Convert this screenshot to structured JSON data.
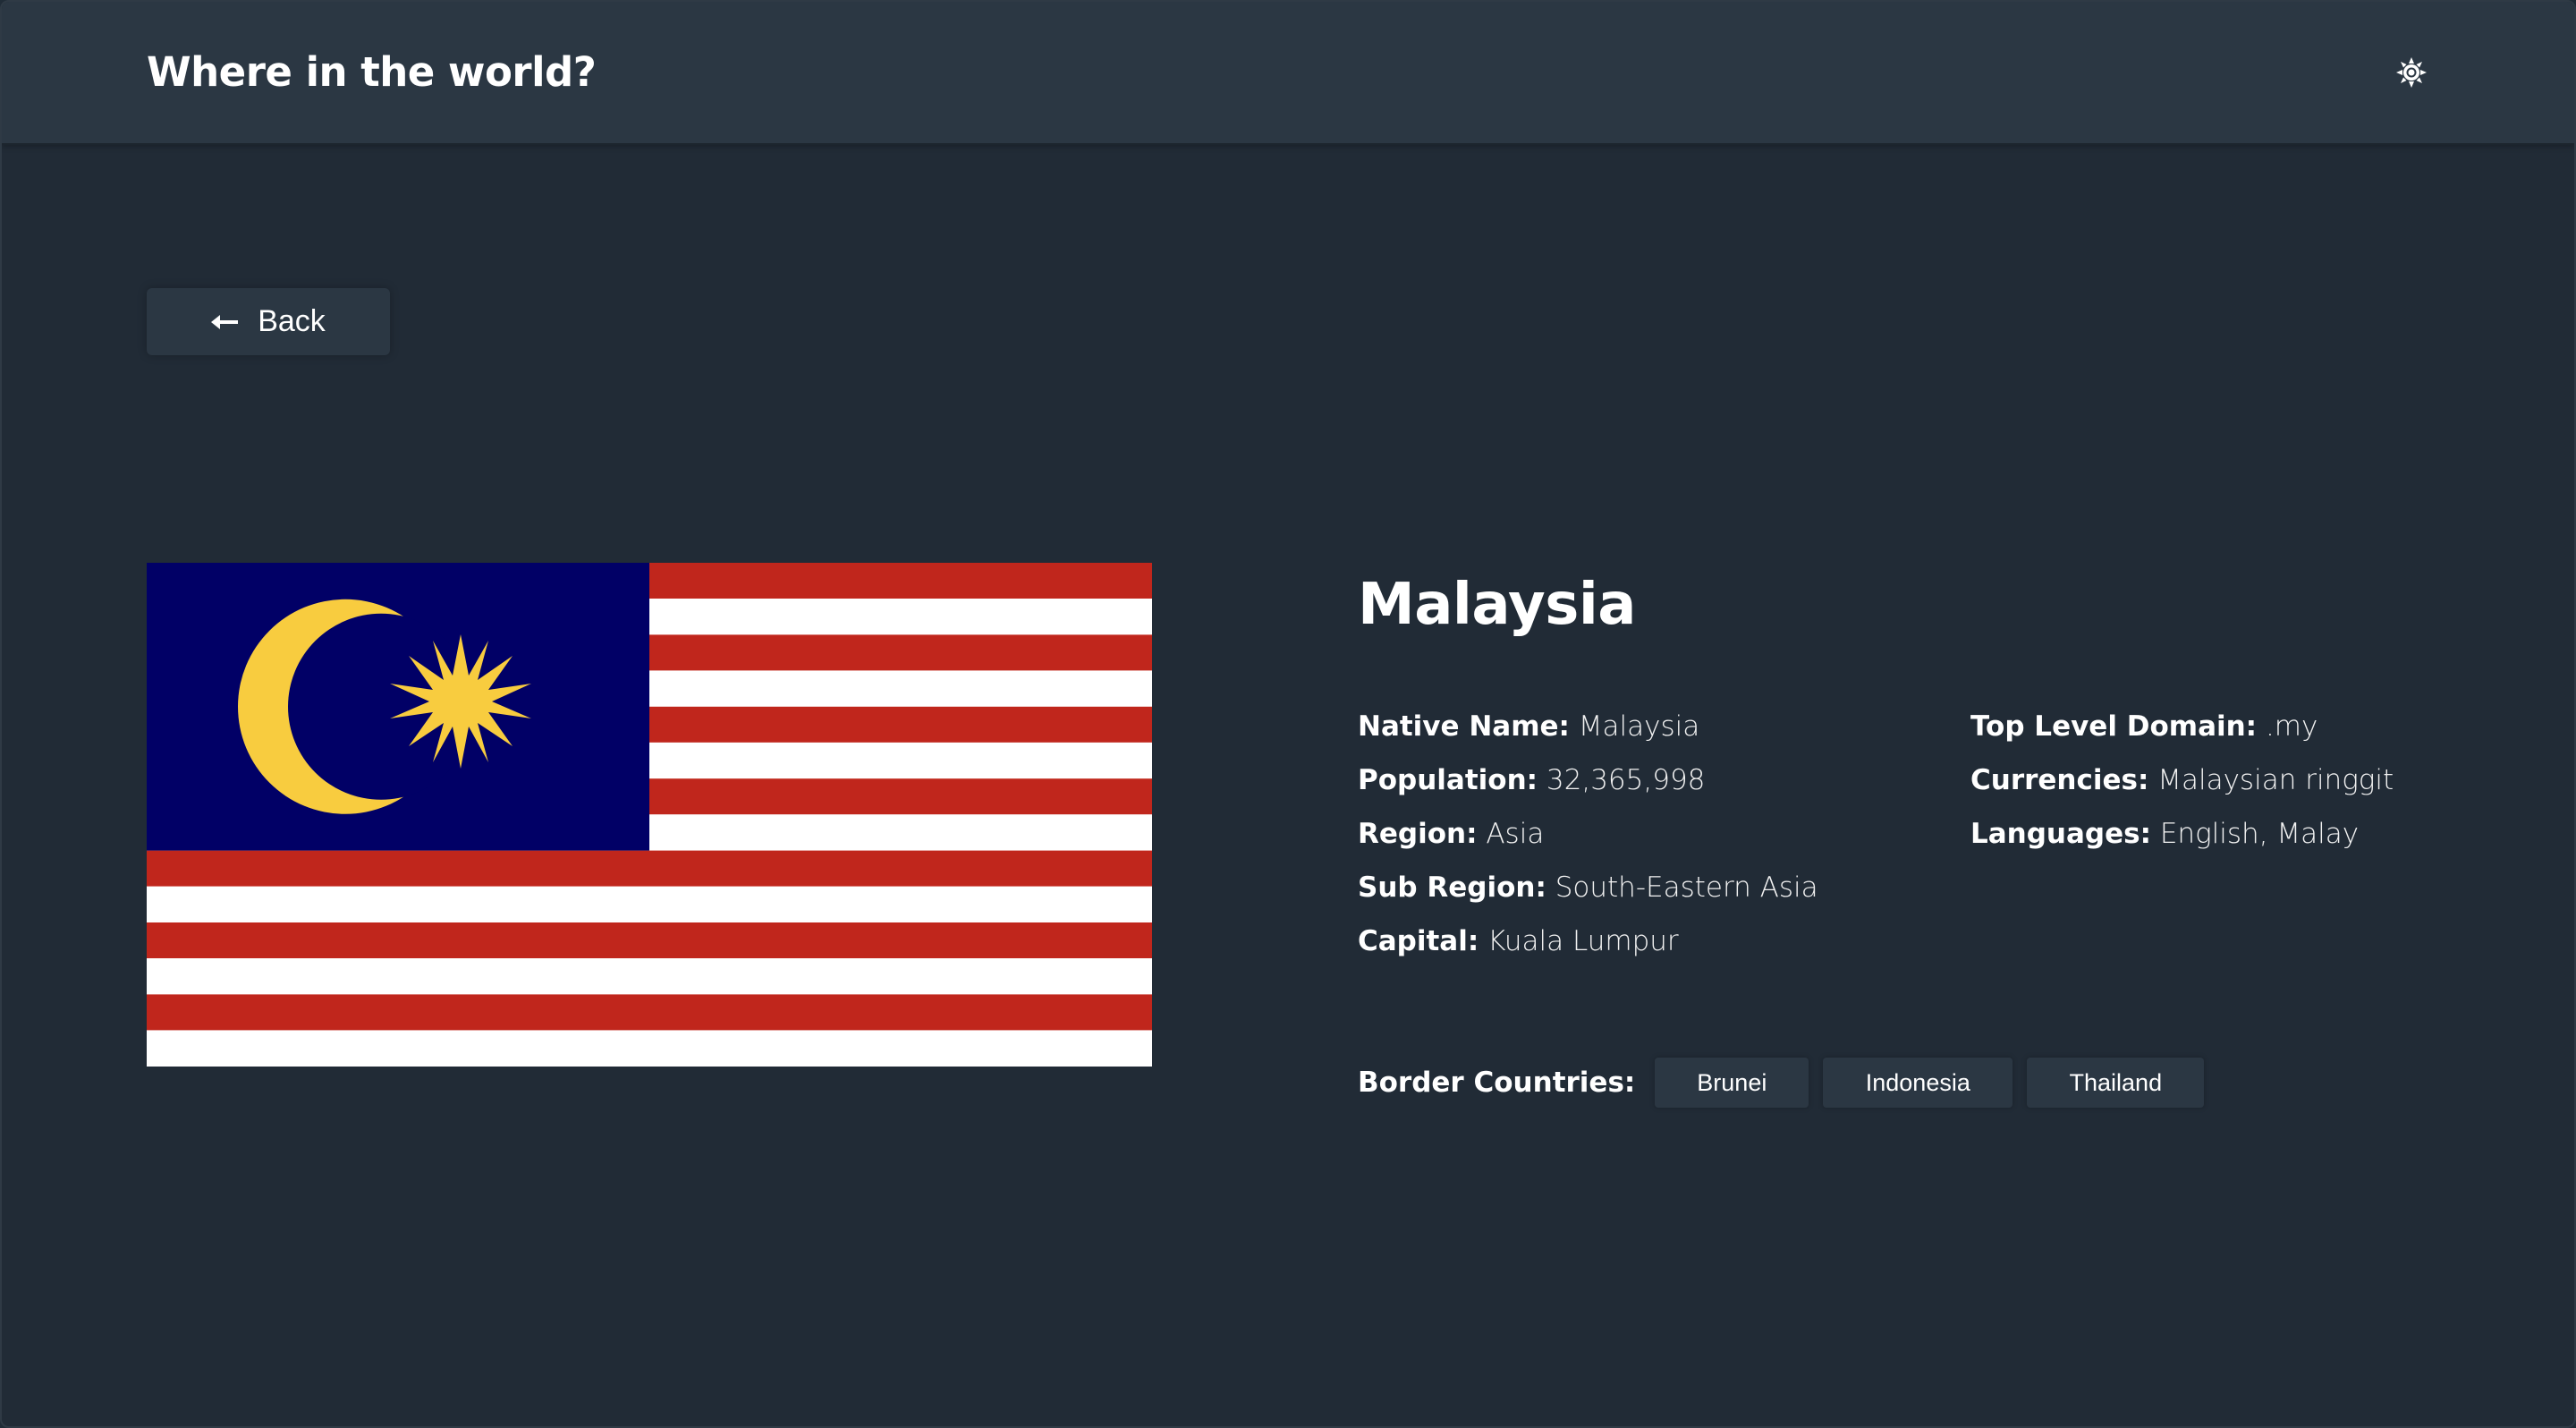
{
  "header": {
    "title": "Where in the world?",
    "theme_icon": "sun-icon"
  },
  "back_button": {
    "icon": "arrow-left-icon",
    "label": "Back"
  },
  "country": {
    "name": "Malaysia",
    "flag_icon": "malaysia-flag",
    "colors": {
      "canton": "#010066",
      "red": "#cc0001",
      "white": "#ffffff",
      "yellow": "#ffcc00"
    },
    "left_details": [
      {
        "label": "Native Name:",
        "value": "Malaysia"
      },
      {
        "label": "Population:",
        "value": "32,365,998"
      },
      {
        "label": "Region:",
        "value": "Asia"
      },
      {
        "label": "Sub Region:",
        "value": "South-Eastern Asia"
      },
      {
        "label": "Capital:",
        "value": "Kuala Lumpur"
      }
    ],
    "right_details": [
      {
        "label": "Top Level Domain:",
        "value": ".my"
      },
      {
        "label": "Currencies:",
        "value": "Malaysian ringgit"
      },
      {
        "label": "Languages:",
        "value": "English, Malay"
      }
    ],
    "border_label": "Border Countries:",
    "borders": [
      "Brunei",
      "Indonesia",
      "Thailand"
    ]
  },
  "theme": {
    "background": "#202c37",
    "element": "#2b3743",
    "text": "#ffffff"
  }
}
